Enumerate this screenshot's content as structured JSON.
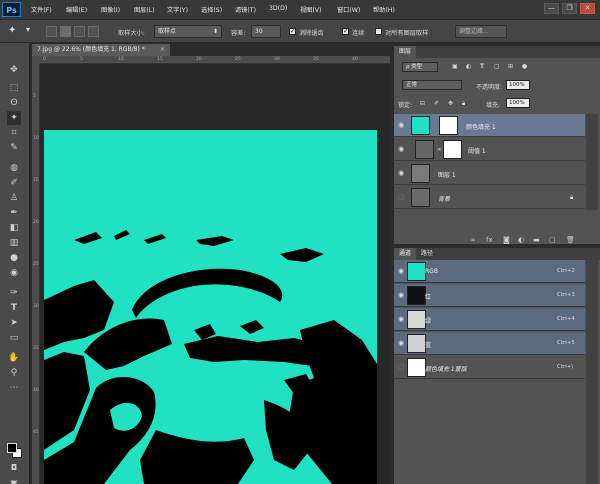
{
  "app": {
    "logo": "Ps"
  },
  "menu": [
    "文件(F)",
    "编辑(E)",
    "图像(I)",
    "图层(L)",
    "文字(Y)",
    "选择(S)",
    "滤镜(T)",
    "3D(D)",
    "视图(V)",
    "窗口(W)",
    "帮助(H)"
  ],
  "window_controls": {
    "minimize": "—",
    "restore": "❐",
    "close": "✕"
  },
  "options": {
    "sample_size_label": "取样大小:",
    "sample_size_value": "取样点",
    "tolerance_label": "容差:",
    "tolerance_value": "30",
    "antialias_label": "消除锯齿",
    "contiguous_label": "连续",
    "sample_all_label": "对所有图层取样",
    "refine_edge_label": "调整边缘..."
  },
  "document": {
    "tab_title": "7.jpg @ 22.6% (颜色填充 1, RGB/8) *",
    "close_glyph": "×",
    "ruler_ticks": [
      "0",
      "5",
      "10",
      "15",
      "20",
      "25",
      "30",
      "35",
      "40"
    ],
    "ruler_left_ticks": [
      "5",
      "10",
      "15",
      "20",
      "25",
      "30",
      "35",
      "40",
      "45"
    ],
    "canvas_fill_color": "#20e2c2"
  },
  "layers_panel": {
    "tab_label": "图层",
    "filter_value": "ρ 类型",
    "blend_mode": "正常",
    "opacity_label": "不透明度:",
    "opacity_value": "100%",
    "lock_label": "锁定:",
    "fill_label": "填充:",
    "fill_value": "100%",
    "layers": [
      {
        "name": "颜色填充 1",
        "selected": true
      },
      {
        "name": "阈值 1",
        "selected": false
      },
      {
        "name": "图层 1",
        "selected": false
      },
      {
        "name": "背景",
        "selected": false
      }
    ]
  },
  "channels_panel": {
    "tabs": [
      "通道",
      "路径"
    ],
    "channels": [
      {
        "name": "RGB",
        "shortcut": "Ctrl+2"
      },
      {
        "name": "红",
        "shortcut": "Ctrl+3"
      },
      {
        "name": "绿",
        "shortcut": "Ctrl+4"
      },
      {
        "name": "蓝",
        "shortcut": "Ctrl+5"
      },
      {
        "name": "颜色填充 1蒙版",
        "shortcut": "Ctrl+\\"
      }
    ]
  },
  "colors": {
    "accent_selection": "#6a7a94",
    "teal": "#20e2c2"
  }
}
